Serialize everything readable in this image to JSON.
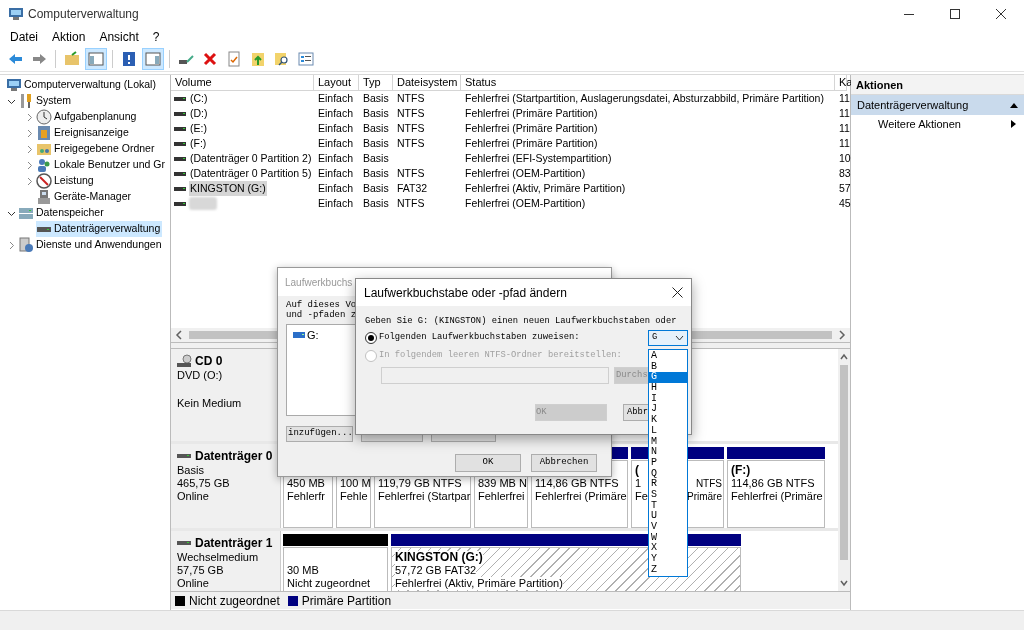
{
  "window": {
    "title": "Computerverwaltung"
  },
  "menu": [
    "Datei",
    "Aktion",
    "Ansicht",
    "?"
  ],
  "toolbar": [
    {
      "pressed": false
    },
    {
      "pressed": false
    },
    {
      "pressed": false
    },
    {
      "pressed": true
    },
    {
      "pressed": false
    },
    {
      "pressed": true
    },
    {
      "pressed": false
    },
    {
      "pressed": false
    },
    {
      "pressed": false
    },
    {
      "pressed": false
    },
    {
      "pressed": false
    },
    {
      "pressed": false
    }
  ],
  "tree": [
    {
      "label": "Computerverwaltung (Lokal)",
      "selected": false,
      "children": [
        {
          "label": "System",
          "expanded": true,
          "selected": false,
          "children": [
            {
              "label": "Aufgabenplanung",
              "expanded": false,
              "selected": false
            },
            {
              "label": "Ereignisanzeige",
              "expanded": false,
              "selected": false
            },
            {
              "label": "Freigegebene Ordner",
              "expanded": false,
              "selected": false
            },
            {
              "label": "Lokale Benutzer und Gr",
              "expanded": false,
              "selected": false
            },
            {
              "label": "Leistung",
              "expanded": false,
              "selected": false
            },
            {
              "label": "Geräte-Manager",
              "selected": false
            }
          ]
        },
        {
          "label": "Datenspeicher",
          "expanded": true,
          "selected": false,
          "children": [
            {
              "label": "Datenträgerverwaltung",
              "selected": true
            }
          ]
        },
        {
          "label": "Dienste und Anwendungen",
          "expanded": false,
          "selected": false
        }
      ]
    }
  ],
  "table": {
    "columns": [
      "Volume",
      "Layout",
      "Typ",
      "Dateisystem",
      "Status",
      "Ka"
    ],
    "rows": [
      {
        "volume": "(C:)",
        "layout": "Einfach",
        "type": "Basis",
        "filesystem": "NTFS",
        "status": "Fehlerfrei (Startpartition, Auslagerungsdatei, Absturzabbild, Primäre Partition)",
        "capacity": "11",
        "selected": false
      },
      {
        "volume": "(D:)",
        "layout": "Einfach",
        "type": "Basis",
        "filesystem": "NTFS",
        "status": "Fehlerfrei (Primäre Partition)",
        "capacity": "11",
        "selected": false
      },
      {
        "volume": "(E:)",
        "layout": "Einfach",
        "type": "Basis",
        "filesystem": "NTFS",
        "status": "Fehlerfrei (Primäre Partition)",
        "capacity": "11",
        "selected": false
      },
      {
        "volume": "(F:)",
        "layout": "Einfach",
        "type": "Basis",
        "filesystem": "NTFS",
        "status": "Fehlerfrei (Primäre Partition)",
        "capacity": "11",
        "selected": false
      },
      {
        "volume": "(Datenträger 0 Partition 2)",
        "layout": "Einfach",
        "type": "Basis",
        "status": "Fehlerfrei (EFI-Systempartition)",
        "capacity": "10",
        "selected": false
      },
      {
        "volume": "(Datenträger 0 Partition 5)",
        "layout": "Einfach",
        "type": "Basis",
        "filesystem": "NTFS",
        "status": "Fehlerfrei (OEM-Partition)",
        "capacity": "83",
        "selected": false
      },
      {
        "volume": "KINGSTON (G:)",
        "layout": "Einfach",
        "type": "Basis",
        "filesystem": "FAT32",
        "status": "Fehlerfrei (Aktiv, Primäre Partition)",
        "capacity": "57",
        "selected": true
      },
      {
        "redacted": true,
        "layout": "Einfach",
        "type": "Basis",
        "filesystem": "NTFS",
        "status": "Fehlerfrei (OEM-Partition)",
        "capacity": "45",
        "selected": false
      }
    ]
  },
  "disks": [
    {
      "kind": "cd",
      "name": "CD 0",
      "type_line": "DVD (O:)",
      "status": "Kein Medium"
    },
    {
      "kind": "disk",
      "name": "Datenträger 0",
      "type_line": "Basis",
      "size": "465,75 GB",
      "status": "Online",
      "partitions": [
        {
          "kind": "primary",
          "size": "450 MB",
          "status": "Fehlerfr",
          "selected": false
        },
        {
          "kind": "primary",
          "size": "100 M",
          "status": "Fehle",
          "selected": false
        },
        {
          "kind": "primary",
          "size": "119,79 GB NTFS",
          "status": "Fehlerfrei (Startpar",
          "selected": false
        },
        {
          "kind": "primary",
          "size": "839 MB N",
          "status": "Fehlerfrei",
          "selected": false
        },
        {
          "kind": "primary",
          "size": "114,86 GB NTFS",
          "status": "Fehlerfrei (Primäre",
          "selected": false
        },
        {
          "kind": "primary",
          "label": "(",
          "size": "1",
          "size_right": "NTFS",
          "status": "Fe",
          "status_right": "Primäre",
          "selected": false
        },
        {
          "kind": "primary",
          "label": "(F:)",
          "size": "114,86 GB NTFS",
          "status": "Fehlerfrei (Primäre",
          "selected": false
        }
      ]
    },
    {
      "kind": "disk",
      "name": "Datenträger 1",
      "type_line": "Wechselmedium",
      "size": "57,75 GB",
      "status": "Online",
      "partitions": [
        {
          "kind": "unallocated",
          "size": "30 MB",
          "status": "Nicht zugeordnet",
          "selected": false
        },
        {
          "kind": "primary",
          "label": "KINGSTON  (G:)",
          "size": "57,72 GB FAT32",
          "status": "Fehlerfrei (Aktiv, Primäre Partition)",
          "selected": true
        }
      ]
    }
  ],
  "legend": [
    {
      "kind": "unallocated",
      "label": "Nicht zugeordnet"
    },
    {
      "kind": "primary",
      "label": "Primäre Partition"
    }
  ],
  "actions": {
    "title": "Aktionen",
    "section": {
      "label": "Datenträgerverwaltung",
      "expanded": true
    },
    "items": [
      {
        "label": "Weitere Aktionen"
      }
    ]
  },
  "back_dialog": {
    "title": "Laufwerkbuchs",
    "text_lines": [
      "Auf dieses Vo",
      "und -pfaden z"
    ],
    "list": [
      {
        "label": "G:"
      }
    ],
    "add_button": "inzufügen...",
    "buttons": [
      "OK",
      "Abbrechen"
    ]
  },
  "dialog": {
    "title": "Laufwerkbuchstabe oder -pfad ändern",
    "prompt": "Geben Sie G: (KINGSTON) einen neuen Laufwerkbuchstaben oder",
    "options": [
      {
        "label": "Folgenden Laufwerkbuchstaben zuweisen:",
        "selected": true,
        "disabled": false
      },
      {
        "label": "In folgendem leeren NTFS-Ordner bereitstellen:",
        "selected": false,
        "disabled": true
      }
    ],
    "combo": {
      "value": "G",
      "expanded": true
    },
    "folder_field": {
      "disabled": true
    },
    "browse_button": {
      "label": "Durchs",
      "disabled": true
    },
    "buttons": [
      {
        "label": "OK",
        "disabled": true
      },
      {
        "label": "Abbr",
        "disabled": false
      }
    ],
    "dropdown": [
      {
        "label": "A",
        "selected": false
      },
      {
        "label": "B",
        "selected": false
      },
      {
        "label": "G",
        "selected": true
      },
      {
        "label": "H",
        "selected": false
      },
      {
        "label": "I",
        "selected": false
      },
      {
        "label": "J",
        "selected": false
      },
      {
        "label": "K",
        "selected": false
      },
      {
        "label": "L",
        "selected": false
      },
      {
        "label": "M",
        "selected": false
      },
      {
        "label": "N",
        "selected": false
      },
      {
        "label": "P",
        "selected": false
      },
      {
        "label": "Q",
        "selected": false
      },
      {
        "label": "R",
        "selected": false
      },
      {
        "label": "S",
        "selected": false
      },
      {
        "label": "T",
        "selected": false
      },
      {
        "label": "U",
        "selected": false
      },
      {
        "label": "V",
        "selected": false
      },
      {
        "label": "W",
        "selected": false
      },
      {
        "label": "X",
        "selected": false
      },
      {
        "label": "Y",
        "selected": false
      },
      {
        "label": "Z",
        "selected": false
      }
    ]
  }
}
